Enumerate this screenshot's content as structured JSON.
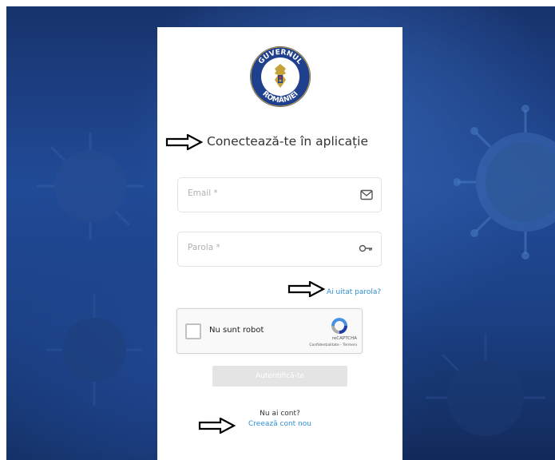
{
  "logo": {
    "lines": [
      "GUVERNUL",
      "ROMÂNIEI"
    ],
    "ring_color": "#1f3f8f"
  },
  "login": {
    "title": "Conectează-te în aplicație",
    "email_placeholder": "Email *",
    "email_icon": "envelope-icon",
    "password_placeholder": "Parola *",
    "password_icon": "key-icon",
    "forgot_password": "Ai uitat parola?",
    "captcha_label": "Nu sunt robot",
    "captcha_brand": "reCAPTCHA",
    "captcha_privacy": "Confidențialitate - Termeni",
    "submit": "Autentifică-te",
    "no_account": "Nu ai cont?",
    "create_account": "Creează cont nou"
  },
  "colors": {
    "link": "#2f8fd6",
    "background_dark": "#18336d",
    "disabled_button": "#e4e4e4"
  }
}
